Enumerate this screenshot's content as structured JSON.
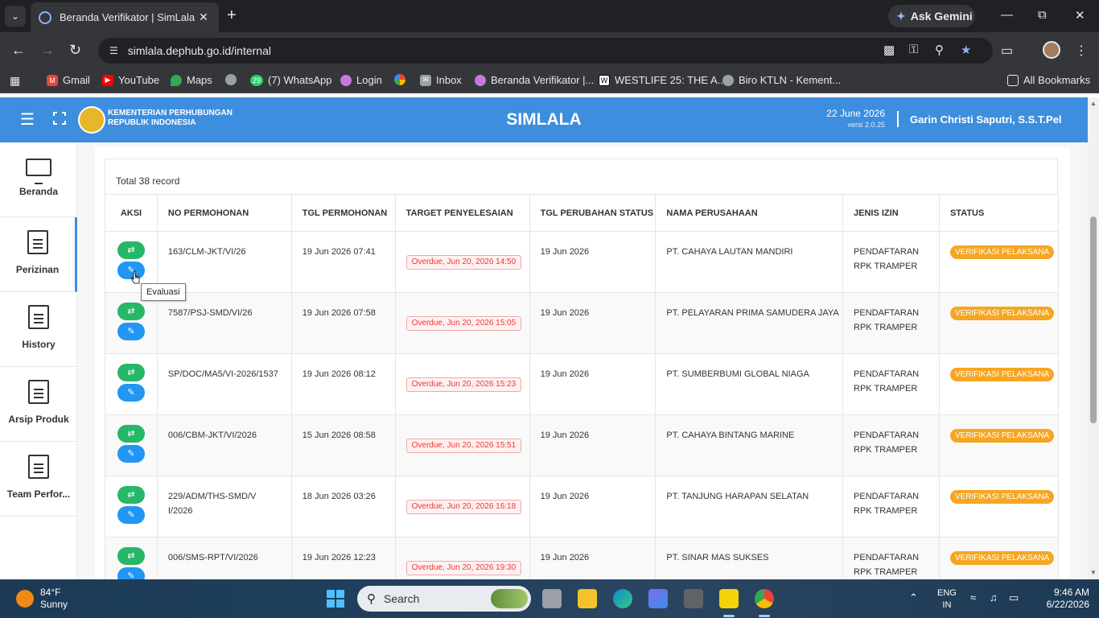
{
  "browser": {
    "tab_title": "Beranda Verifikator | SimLala",
    "new_tab": "+",
    "gemini_label": "Ask Gemini",
    "url": "simlala.dephub.go.id/internal",
    "bookmarks": [
      {
        "label": "Gmail",
        "color": "#ea4335"
      },
      {
        "label": "YouTube",
        "color": "#ff0000"
      },
      {
        "label": "Maps",
        "color": "#34a853"
      },
      {
        "label": "",
        "color": "#9aa0a6"
      },
      {
        "label": "(7) WhatsApp",
        "color": "#25d366"
      },
      {
        "label": "Login",
        "color": "#c47ad8"
      },
      {
        "label": "",
        "color": "#fbbc04"
      },
      {
        "label": "Inbox",
        "color": "#9aa0a6"
      },
      {
        "label": "Beranda Verifikator |...",
        "color": "#c47ad8"
      },
      {
        "label": "WESTLIFE 25: THE A...",
        "color": "#ffffff"
      },
      {
        "label": "Biro KTLN - Kement...",
        "color": "#9aa0a6"
      }
    ],
    "all_bookmarks": "All Bookmarks",
    "whatsapp_badge": "29"
  },
  "header": {
    "org_line1": "KEMENTERIAN PERHUBUNGAN",
    "org_line2": "REPUBLIK INDONESIA",
    "title": "SIMLALA",
    "date": "22 June 2026",
    "version": "versi 2.0.25",
    "user": "Garin Christi Saputri, S.S.T.Pel"
  },
  "sidenav": [
    {
      "label": "Beranda",
      "icon": "monitor-icon",
      "active": false
    },
    {
      "label": "Perizinan",
      "icon": "document-icon",
      "active": true
    },
    {
      "label": "History",
      "icon": "document-icon",
      "active": false
    },
    {
      "label": "Arsip Produk",
      "icon": "document-icon",
      "active": false
    },
    {
      "label": "Team Perfor...",
      "icon": "document-icon",
      "active": false
    }
  ],
  "table": {
    "total_label": "Total 38 record",
    "columns": [
      "AKSI",
      "NO PERMOHONAN",
      "TGL PERMOHONAN",
      "TARGET PENYELESAIAN",
      "TGL PERUBAHAN STATUS",
      "NAMA PERUSAHAAN",
      "JENIS IZIN",
      "STATUS"
    ],
    "rows": [
      {
        "no": "163/CLM-JKT/VI/26",
        "tgl": "19 Jun 2026 07:41",
        "target": "Overdue, Jun 20, 2026 14:50",
        "ubah": "19 Jun 2026",
        "perusahaan": "PT. CAHAYA LAUTAN MANDIRI",
        "izin": "PENDAFTARAN RPK TRAMPER",
        "status": "VERIFIKASI PELAKSANA"
      },
      {
        "no": "7587/PSJ-SMD/VI/26",
        "tgl": "19 Jun 2026 07:58",
        "target": "Overdue, Jun 20, 2026 15:05",
        "ubah": "19 Jun 2026",
        "perusahaan": "PT. PELAYARAN PRIMA SAMUDERA JAYA",
        "izin": "PENDAFTARAN RPK TRAMPER",
        "status": "VERIFIKASI PELAKSANA"
      },
      {
        "no": "SP/DOC/MA5/VI-2026/1537",
        "tgl": "19 Jun 2026 08:12",
        "target": "Overdue, Jun 20, 2026 15:23",
        "ubah": "19 Jun 2026",
        "perusahaan": "PT. SUMBERBUMI GLOBAL NIAGA",
        "izin": "PENDAFTARAN RPK TRAMPER",
        "status": "VERIFIKASI PELAKSANA"
      },
      {
        "no": "006/CBM-JKT/VI/2026",
        "tgl": "15 Jun 2026 08:58",
        "target": "Overdue, Jun 20, 2026 15:51",
        "ubah": "19 Jun 2026",
        "perusahaan": "PT. CAHAYA BINTANG MARINE",
        "izin": "PENDAFTARAN RPK TRAMPER",
        "status": "VERIFIKASI PELAKSANA"
      },
      {
        "no": "229/ADM/THS-SMD/VI/2026",
        "tgl": "18 Jun 2026 03:26",
        "target": "Overdue, Jun 20, 2026 16:18",
        "ubah": "19 Jun 2026",
        "perusahaan": "PT. TANJUNG HARAPAN SELATAN",
        "izin": "PENDAFTARAN RPK TRAMPER",
        "status": "VERIFIKASI PELAKSANA"
      },
      {
        "no": "006/SMS-RPT/VI/2026",
        "tgl": "19 Jun 2026 12:23",
        "target": "Overdue, Jun 20, 2026 19:30",
        "ubah": "19 Jun 2026",
        "perusahaan": "PT. SINAR MAS SUKSES",
        "izin": "PENDAFTARAN RPK TRAMPER",
        "status": "VERIFIKASI PELAKSANA"
      }
    ],
    "tooltip": "Evaluasi"
  },
  "taskbar": {
    "temp": "84°F",
    "weather": "Sunny",
    "search": "Search",
    "lang1": "ENG",
    "lang2": "IN",
    "time": "9:46 AM",
    "date": "6/22/2026"
  },
  "colors": {
    "header_blue": "#3d8ede",
    "action_green": "#26b768",
    "action_blue": "#2196f3",
    "status_orange": "#f5a623",
    "overdue_red": "#e53935"
  }
}
